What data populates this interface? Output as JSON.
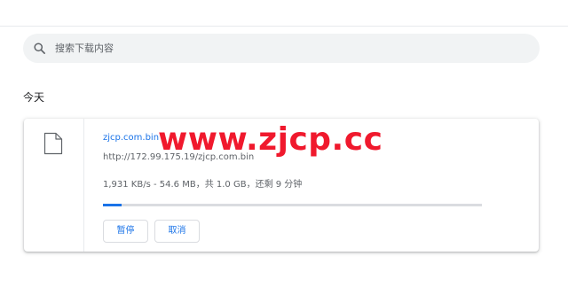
{
  "search": {
    "placeholder": "搜索下载内容",
    "value": ""
  },
  "section": {
    "title": "今天"
  },
  "download": {
    "file_name": "zjcp.com.bin",
    "url": "http://172.99.175.19/zjcp.com.bin",
    "status": "1,931 KB/s - 54.6 MB，共 1.0 GB，还剩 9 分钟",
    "progress_percent": 5,
    "pause_label": "暂停",
    "cancel_label": "取消"
  },
  "watermark": {
    "text": "www.zjcp.cc"
  },
  "colors": {
    "accent": "#1a73e8",
    "watermark": "#f0192d",
    "search_background": "#f1f3f4",
    "progress_track": "#dadce0"
  },
  "icons": {
    "search": "search-icon",
    "file": "file-icon"
  }
}
